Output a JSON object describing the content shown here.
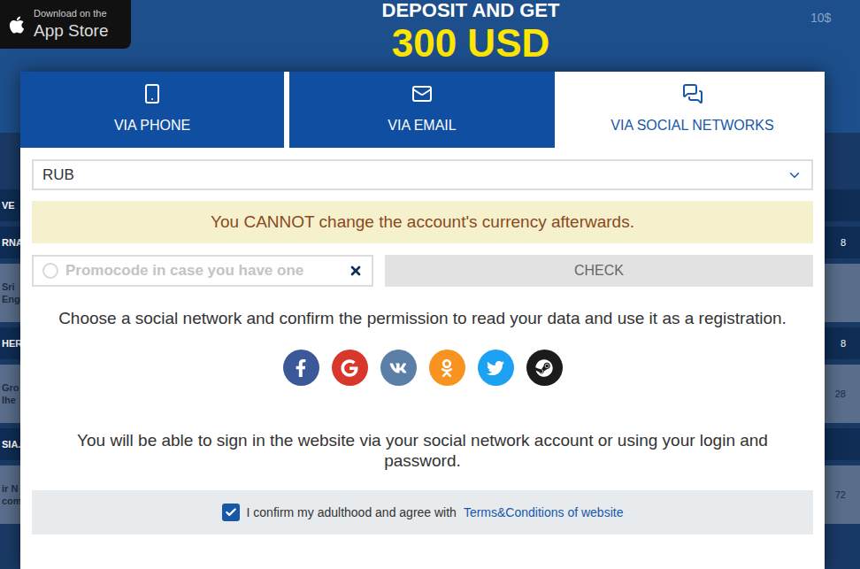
{
  "background": {
    "app_store_badge": {
      "line1": "Download on the",
      "line2": "App Store"
    },
    "promo_banner": {
      "title": "DEPOSIT AND GET",
      "amount": "300 USD"
    },
    "side_value": "10$",
    "rows": [
      {
        "kind": "header",
        "left": [
          "VE"
        ],
        "right": ""
      },
      {
        "kind": "header",
        "left": [
          "RNA"
        ],
        "right": "8"
      },
      {
        "kind": "row",
        "left": [
          "Sri",
          "Eng"
        ],
        "right": ""
      },
      {
        "kind": "header",
        "left": [
          "HER"
        ],
        "right": "8"
      },
      {
        "kind": "row",
        "left": [
          "Gro",
          "lhe"
        ],
        "right": "28"
      },
      {
        "kind": "header",
        "left": [
          "SIA."
        ],
        "right": ""
      },
      {
        "kind": "row",
        "left": [
          "ir N",
          "com"
        ],
        "right": "72"
      }
    ]
  },
  "modal": {
    "tabs": [
      {
        "label": "VIA PHONE",
        "selected": false,
        "kind": "phone"
      },
      {
        "label": "VIA EMAIL",
        "selected": false,
        "kind": "email"
      },
      {
        "label": "VIA SOCIAL NETWORKS",
        "selected": true,
        "kind": "social"
      }
    ],
    "currency": {
      "value": "RUB"
    },
    "warning": "You CANNOT change the account's currency afterwards.",
    "promocode": {
      "placeholder": "Promocode in case you have one",
      "button": "CHECK"
    },
    "instruction": "Choose a social network and confirm the permission to read your data and use it as a registration.",
    "social_networks": [
      {
        "kind": "facebook",
        "color": "#3b5998"
      },
      {
        "kind": "google",
        "color": "#d8372b"
      },
      {
        "kind": "vk",
        "color": "#5c7fa8"
      },
      {
        "kind": "odnoklassniki",
        "color": "#f7931e"
      },
      {
        "kind": "twitter",
        "color": "#1da1f2"
      },
      {
        "kind": "steam",
        "color": "#1b1b1b"
      }
    ],
    "sign_in_note": "You will be able to sign in the website via your social network account or using your login and password.",
    "consent": {
      "checked": true,
      "text": "I confirm my adulthood and agree with",
      "link": "Terms&Conditions of website"
    }
  }
}
